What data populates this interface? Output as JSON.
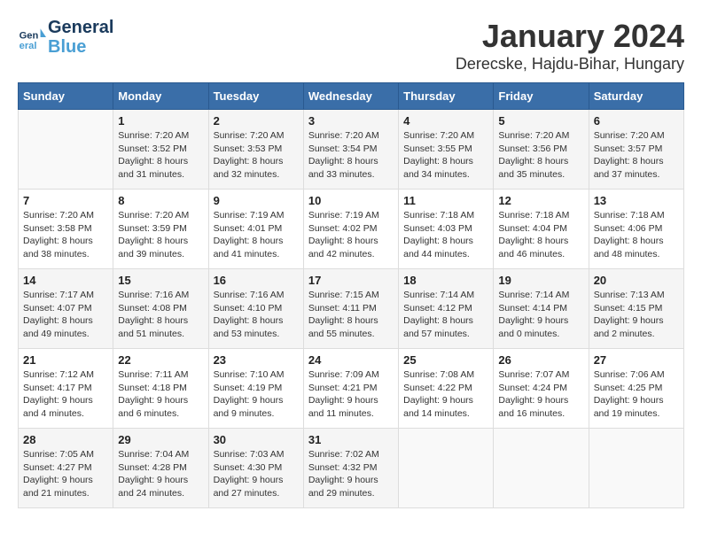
{
  "header": {
    "logo_line1": "General",
    "logo_line2": "Blue",
    "month_year": "January 2024",
    "location": "Derecske, Hajdu-Bihar, Hungary"
  },
  "weekdays": [
    "Sunday",
    "Monday",
    "Tuesday",
    "Wednesday",
    "Thursday",
    "Friday",
    "Saturday"
  ],
  "weeks": [
    [
      {
        "day": "",
        "info": ""
      },
      {
        "day": "1",
        "info": "Sunrise: 7:20 AM\nSunset: 3:52 PM\nDaylight: 8 hours\nand 31 minutes."
      },
      {
        "day": "2",
        "info": "Sunrise: 7:20 AM\nSunset: 3:53 PM\nDaylight: 8 hours\nand 32 minutes."
      },
      {
        "day": "3",
        "info": "Sunrise: 7:20 AM\nSunset: 3:54 PM\nDaylight: 8 hours\nand 33 minutes."
      },
      {
        "day": "4",
        "info": "Sunrise: 7:20 AM\nSunset: 3:55 PM\nDaylight: 8 hours\nand 34 minutes."
      },
      {
        "day": "5",
        "info": "Sunrise: 7:20 AM\nSunset: 3:56 PM\nDaylight: 8 hours\nand 35 minutes."
      },
      {
        "day": "6",
        "info": "Sunrise: 7:20 AM\nSunset: 3:57 PM\nDaylight: 8 hours\nand 37 minutes."
      }
    ],
    [
      {
        "day": "7",
        "info": "Sunrise: 7:20 AM\nSunset: 3:58 PM\nDaylight: 8 hours\nand 38 minutes."
      },
      {
        "day": "8",
        "info": "Sunrise: 7:20 AM\nSunset: 3:59 PM\nDaylight: 8 hours\nand 39 minutes."
      },
      {
        "day": "9",
        "info": "Sunrise: 7:19 AM\nSunset: 4:01 PM\nDaylight: 8 hours\nand 41 minutes."
      },
      {
        "day": "10",
        "info": "Sunrise: 7:19 AM\nSunset: 4:02 PM\nDaylight: 8 hours\nand 42 minutes."
      },
      {
        "day": "11",
        "info": "Sunrise: 7:18 AM\nSunset: 4:03 PM\nDaylight: 8 hours\nand 44 minutes."
      },
      {
        "day": "12",
        "info": "Sunrise: 7:18 AM\nSunset: 4:04 PM\nDaylight: 8 hours\nand 46 minutes."
      },
      {
        "day": "13",
        "info": "Sunrise: 7:18 AM\nSunset: 4:06 PM\nDaylight: 8 hours\nand 48 minutes."
      }
    ],
    [
      {
        "day": "14",
        "info": "Sunrise: 7:17 AM\nSunset: 4:07 PM\nDaylight: 8 hours\nand 49 minutes."
      },
      {
        "day": "15",
        "info": "Sunrise: 7:16 AM\nSunset: 4:08 PM\nDaylight: 8 hours\nand 51 minutes."
      },
      {
        "day": "16",
        "info": "Sunrise: 7:16 AM\nSunset: 4:10 PM\nDaylight: 8 hours\nand 53 minutes."
      },
      {
        "day": "17",
        "info": "Sunrise: 7:15 AM\nSunset: 4:11 PM\nDaylight: 8 hours\nand 55 minutes."
      },
      {
        "day": "18",
        "info": "Sunrise: 7:14 AM\nSunset: 4:12 PM\nDaylight: 8 hours\nand 57 minutes."
      },
      {
        "day": "19",
        "info": "Sunrise: 7:14 AM\nSunset: 4:14 PM\nDaylight: 9 hours\nand 0 minutes."
      },
      {
        "day": "20",
        "info": "Sunrise: 7:13 AM\nSunset: 4:15 PM\nDaylight: 9 hours\nand 2 minutes."
      }
    ],
    [
      {
        "day": "21",
        "info": "Sunrise: 7:12 AM\nSunset: 4:17 PM\nDaylight: 9 hours\nand 4 minutes."
      },
      {
        "day": "22",
        "info": "Sunrise: 7:11 AM\nSunset: 4:18 PM\nDaylight: 9 hours\nand 6 minutes."
      },
      {
        "day": "23",
        "info": "Sunrise: 7:10 AM\nSunset: 4:19 PM\nDaylight: 9 hours\nand 9 minutes."
      },
      {
        "day": "24",
        "info": "Sunrise: 7:09 AM\nSunset: 4:21 PM\nDaylight: 9 hours\nand 11 minutes."
      },
      {
        "day": "25",
        "info": "Sunrise: 7:08 AM\nSunset: 4:22 PM\nDaylight: 9 hours\nand 14 minutes."
      },
      {
        "day": "26",
        "info": "Sunrise: 7:07 AM\nSunset: 4:24 PM\nDaylight: 9 hours\nand 16 minutes."
      },
      {
        "day": "27",
        "info": "Sunrise: 7:06 AM\nSunset: 4:25 PM\nDaylight: 9 hours\nand 19 minutes."
      }
    ],
    [
      {
        "day": "28",
        "info": "Sunrise: 7:05 AM\nSunset: 4:27 PM\nDaylight: 9 hours\nand 21 minutes."
      },
      {
        "day": "29",
        "info": "Sunrise: 7:04 AM\nSunset: 4:28 PM\nDaylight: 9 hours\nand 24 minutes."
      },
      {
        "day": "30",
        "info": "Sunrise: 7:03 AM\nSunset: 4:30 PM\nDaylight: 9 hours\nand 27 minutes."
      },
      {
        "day": "31",
        "info": "Sunrise: 7:02 AM\nSunset: 4:32 PM\nDaylight: 9 hours\nand 29 minutes."
      },
      {
        "day": "",
        "info": ""
      },
      {
        "day": "",
        "info": ""
      },
      {
        "day": "",
        "info": ""
      }
    ]
  ]
}
